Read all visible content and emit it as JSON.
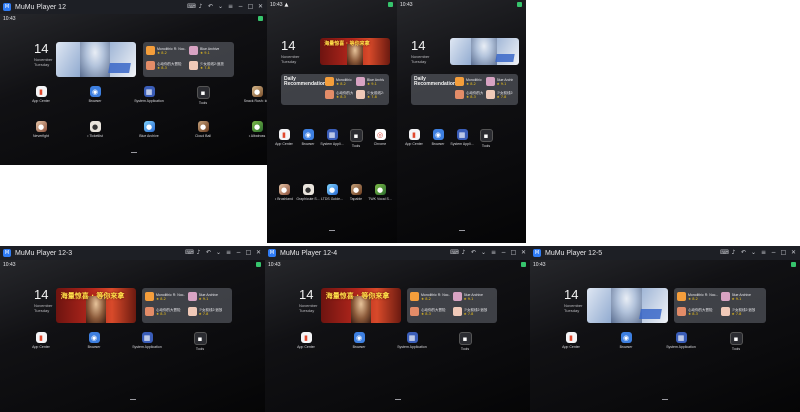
{
  "windows": [
    {
      "title": "MuMu Player 12",
      "status_time": "10:43",
      "clock": {
        "day": "14",
        "month": "November",
        "weekday": "Tuesday"
      },
      "banner": {
        "style": "anime",
        "text": ""
      },
      "rec_title": "",
      "rec_items": [
        {
          "name": "Monolithic R: Noc...",
          "stars": "★ 8.2"
        },
        {
          "name": "Blue Archive",
          "stars": "★ 9.1"
        },
        {
          "name": "心动你的大冒险",
          "stars": "★ 8.3"
        },
        {
          "name": "少女前线2:追放",
          "stars": "★ 7.8"
        }
      ],
      "apps": [
        {
          "label": "App Center",
          "icon": "store-icon",
          "glyph": "▮"
        },
        {
          "label": "Browser",
          "icon": "browser-icon",
          "glyph": "◉"
        },
        {
          "label": "System Application",
          "icon": "system-apps-icon",
          "glyph": "▦"
        },
        {
          "label": "Tools",
          "icon": "tools-icon",
          "glyph": "▪"
        },
        {
          "label": "Snack Rush: Idle",
          "icon": "game-icon",
          "glyph": "●"
        },
        {
          "label": "Neverfight",
          "icon": "game-icon",
          "glyph": "●"
        },
        {
          "label": "• Ticketlist",
          "icon": "game-icon",
          "glyph": "●"
        },
        {
          "label": "Blue Archive",
          "icon": "game-icon",
          "glyph": "●"
        },
        {
          "label": "Cloud Ball",
          "icon": "game-icon",
          "glyph": "●"
        },
        {
          "label": "• Albatross",
          "icon": "game-icon",
          "glyph": "●"
        }
      ]
    },
    {
      "title": "",
      "status_time": "10:43",
      "clock": {
        "day": "14",
        "month": "November",
        "weekday": "Tuesday"
      },
      "banner": {
        "style": "cn",
        "text": "海量惊喜 · 等你来拿"
      },
      "rec_title": "Daily Recommendation",
      "rec_items": [
        {
          "name": "Monolithic R: Noc...",
          "stars": "★ 8.2"
        },
        {
          "name": "Blue Archive",
          "stars": "★ 9.1"
        },
        {
          "name": "心动你的大冒险",
          "stars": "★ 8.3"
        },
        {
          "name": "少女前线2:追放",
          "stars": "★ 7.8"
        }
      ],
      "apps": [
        {
          "label": "App Center",
          "icon": "store-icon",
          "glyph": "▮"
        },
        {
          "label": "Browser",
          "icon": "browser-icon",
          "glyph": "◉"
        },
        {
          "label": "System Appli...",
          "icon": "system-apps-icon",
          "glyph": "▦"
        },
        {
          "label": "Tools",
          "icon": "tools-icon",
          "glyph": "▪"
        },
        {
          "label": "Chrome",
          "icon": "chrome-icon",
          "glyph": "◎"
        },
        {
          "label": "• Brushland",
          "icon": "game-icon",
          "glyph": "●"
        },
        {
          "label": "Graphicute S...",
          "icon": "game-icon",
          "glyph": "●"
        },
        {
          "label": "LTDS Golde...",
          "icon": "game-icon",
          "glyph": "●"
        },
        {
          "label": "Tapable",
          "icon": "game-icon",
          "glyph": "●"
        },
        {
          "label": "TWK Vocal S...",
          "icon": "game-icon",
          "glyph": "●"
        }
      ]
    },
    {
      "title": "",
      "status_time": "10:43",
      "clock": {
        "day": "14",
        "month": "November",
        "weekday": "Tuesday"
      },
      "banner": {
        "style": "anime",
        "text": ""
      },
      "rec_title": "Daily Recommendation",
      "rec_items": [
        {
          "name": "Monolithic R: Noc...",
          "stars": "★ 8.2"
        },
        {
          "name": "Blue Archive",
          "stars": "★ 9.1"
        },
        {
          "name": "心动你的大冒险",
          "stars": "★ 8.3"
        },
        {
          "name": "少女前线2:追放",
          "stars": "★ 7.8"
        }
      ],
      "apps": [
        {
          "label": "App Center",
          "icon": "store-icon",
          "glyph": "▮"
        },
        {
          "label": "Browser",
          "icon": "browser-icon",
          "glyph": "◉"
        },
        {
          "label": "System Appli...",
          "icon": "system-apps-icon",
          "glyph": "▦"
        },
        {
          "label": "Tools",
          "icon": "tools-icon",
          "glyph": "▪"
        }
      ]
    },
    {
      "title": "MuMu Player 12-3",
      "status_time": "10:43",
      "clock": {
        "day": "14",
        "month": "November",
        "weekday": "Tuesday"
      },
      "banner": {
        "style": "cn",
        "text": "海量惊喜 · 等你来拿"
      },
      "rec_title": "",
      "rec_items": [
        {
          "name": "Monolithic R: Noc...",
          "stars": "★ 8.2"
        },
        {
          "name": "Blue Archive",
          "stars": "★ 9.1"
        },
        {
          "name": "心动你的大冒险",
          "stars": "★ 8.3"
        },
        {
          "name": "少女前线2:追放",
          "stars": "★ 7.8"
        }
      ],
      "apps": [
        {
          "label": "App Center",
          "icon": "store-icon",
          "glyph": "▮"
        },
        {
          "label": "Browser",
          "icon": "browser-icon",
          "glyph": "◉"
        },
        {
          "label": "System Application",
          "icon": "system-apps-icon",
          "glyph": "▦"
        },
        {
          "label": "Tools",
          "icon": "tools-icon",
          "glyph": "▪"
        }
      ]
    },
    {
      "title": "MuMu Player 12-4",
      "status_time": "10:43",
      "clock": {
        "day": "14",
        "month": "November",
        "weekday": "Tuesday"
      },
      "banner": {
        "style": "cn",
        "text": "海量惊喜 · 等你来拿"
      },
      "rec_title": "",
      "rec_items": [
        {
          "name": "Monolithic R: Noc...",
          "stars": "★ 8.2"
        },
        {
          "name": "Blue Archive",
          "stars": "★ 9.1"
        },
        {
          "name": "心动你的大冒险",
          "stars": "★ 8.3"
        },
        {
          "name": "少女前线2:追放",
          "stars": "★ 7.8"
        }
      ],
      "apps": [
        {
          "label": "App Center",
          "icon": "store-icon",
          "glyph": "▮"
        },
        {
          "label": "Browser",
          "icon": "browser-icon",
          "glyph": "◉"
        },
        {
          "label": "System Application",
          "icon": "system-apps-icon",
          "glyph": "▦"
        },
        {
          "label": "Tools",
          "icon": "tools-icon",
          "glyph": "▪"
        }
      ]
    },
    {
      "title": "MuMu Player 12-5",
      "status_time": "10:43",
      "clock": {
        "day": "14",
        "month": "November",
        "weekday": "Tuesday"
      },
      "banner": {
        "style": "anime",
        "text": ""
      },
      "rec_title": "",
      "rec_items": [
        {
          "name": "Monolithic R: Noc...",
          "stars": "★ 8.2"
        },
        {
          "name": "Blue Archive",
          "stars": "★ 9.1"
        },
        {
          "name": "心动你的大冒险",
          "stars": "★ 8.3"
        },
        {
          "name": "少女前线2:追放",
          "stars": "★ 7.8"
        }
      ],
      "apps": [
        {
          "label": "App Center",
          "icon": "store-icon",
          "glyph": "▮"
        },
        {
          "label": "Browser",
          "icon": "browser-icon",
          "glyph": "◉"
        },
        {
          "label": "System Application",
          "icon": "system-apps-icon",
          "glyph": "▦"
        },
        {
          "label": "Tools",
          "icon": "tools-icon",
          "glyph": "▪"
        }
      ]
    }
  ],
  "titlebar_icons": [
    {
      "name": "keyboard-icon",
      "glyph": "⌨"
    },
    {
      "name": "volume-icon",
      "glyph": "♪"
    },
    {
      "name": "back-icon",
      "glyph": "↶"
    },
    {
      "name": "chevron-down-icon",
      "glyph": "⌄"
    },
    {
      "name": "menu-icon",
      "glyph": "≡"
    },
    {
      "name": "minimize-icon",
      "glyph": "−"
    },
    {
      "name": "maximize-icon",
      "glyph": "□"
    },
    {
      "name": "close-icon",
      "glyph": "✕"
    }
  ]
}
